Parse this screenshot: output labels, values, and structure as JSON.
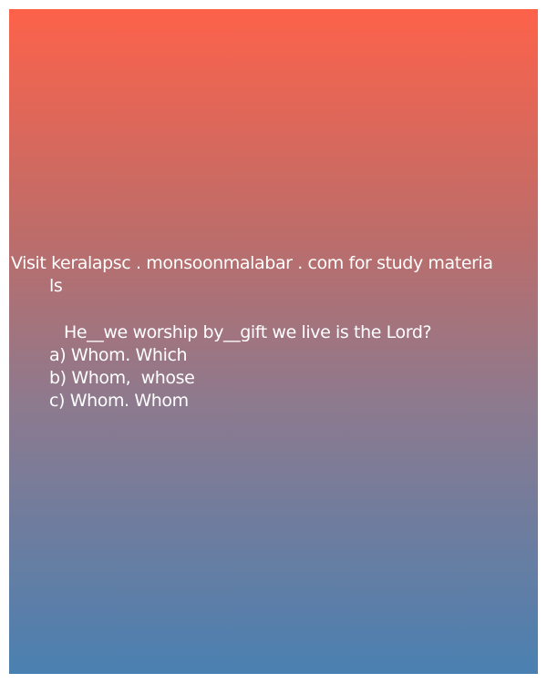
{
  "header": {
    "line1": "Visit keralapsc . monsoonmalabar . com for study materia",
    "line2": "ls"
  },
  "question": {
    "text": "He__we worship by__gift we live is the Lord?"
  },
  "options": [
    "a) Whom. Which",
    "b) Whom,  whose",
    "c) Whom. Whom"
  ]
}
